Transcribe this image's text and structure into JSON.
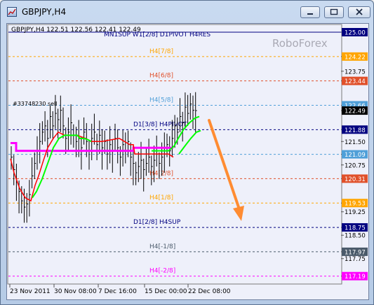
{
  "window": {
    "title": "GBPJPY,H4"
  },
  "chart": {
    "header": "GBPJPY,H4  122.51 122.56 122.41 122.49",
    "header_levels": "MN1SUP W1[2/8] D1PIVOT H4RES",
    "watermark": "RoboForex",
    "order_label": "#33748230 sell",
    "levels": [
      {
        "price": "125.00",
        "label": "",
        "color": "#000080",
        "style": "solid"
      },
      {
        "price": "124.22",
        "label": "H4[7/8]",
        "color": "#ffa500",
        "style": "dash"
      },
      {
        "price": "123.44",
        "label": "H4[6/8]",
        "color": "#e0502a",
        "style": "dash"
      },
      {
        "price": "122.66",
        "label": "H4[5/8]",
        "color": "#4f9fd8",
        "style": "dash"
      },
      {
        "price": "121.88",
        "label": "D1[3/8] H4PIVOT",
        "color": "#000080",
        "style": "dash"
      },
      {
        "price": "121.09",
        "label": "",
        "color": "#4f9fd8",
        "style": "dash"
      },
      {
        "price": "120.31",
        "label": "H4[2/8]",
        "color": "#e0502a",
        "style": "dash"
      },
      {
        "price": "119.53",
        "label": "H4[1/8]",
        "color": "#ffa500",
        "style": "dash"
      },
      {
        "price": "118.75",
        "label": "D1[2/8] H4SUP",
        "color": "#000080",
        "style": "dash"
      },
      {
        "price": "117.97",
        "label": "H4[-1/8]",
        "color": "#4a5a6a",
        "style": "dash"
      },
      {
        "price": "117.19",
        "label": "H4[-2/8]",
        "color": "#ff00ff",
        "style": "dash"
      }
    ],
    "axis_labels": [
      "125.00",
      "124.22",
      "123.75",
      "123.44",
      "122.66",
      "122.49",
      "121.88",
      "121.50",
      "121.09",
      "120.75",
      "120.31",
      "119.53",
      "119.25",
      "118.75",
      "118.50",
      "117.97",
      "117.75",
      "117.19"
    ],
    "current_price": "122.49",
    "time_labels": [
      "23 Nov 2011",
      "30 Nov 08:00",
      "7 Dec 16:00",
      "15 Dec 00:00",
      "22 Dec 08:00"
    ]
  },
  "colors": {
    "magenta_line": "#ff00ff",
    "green_line": "#00ff00",
    "red_line": "#ff0000",
    "arrow": "#ff8c32"
  }
}
